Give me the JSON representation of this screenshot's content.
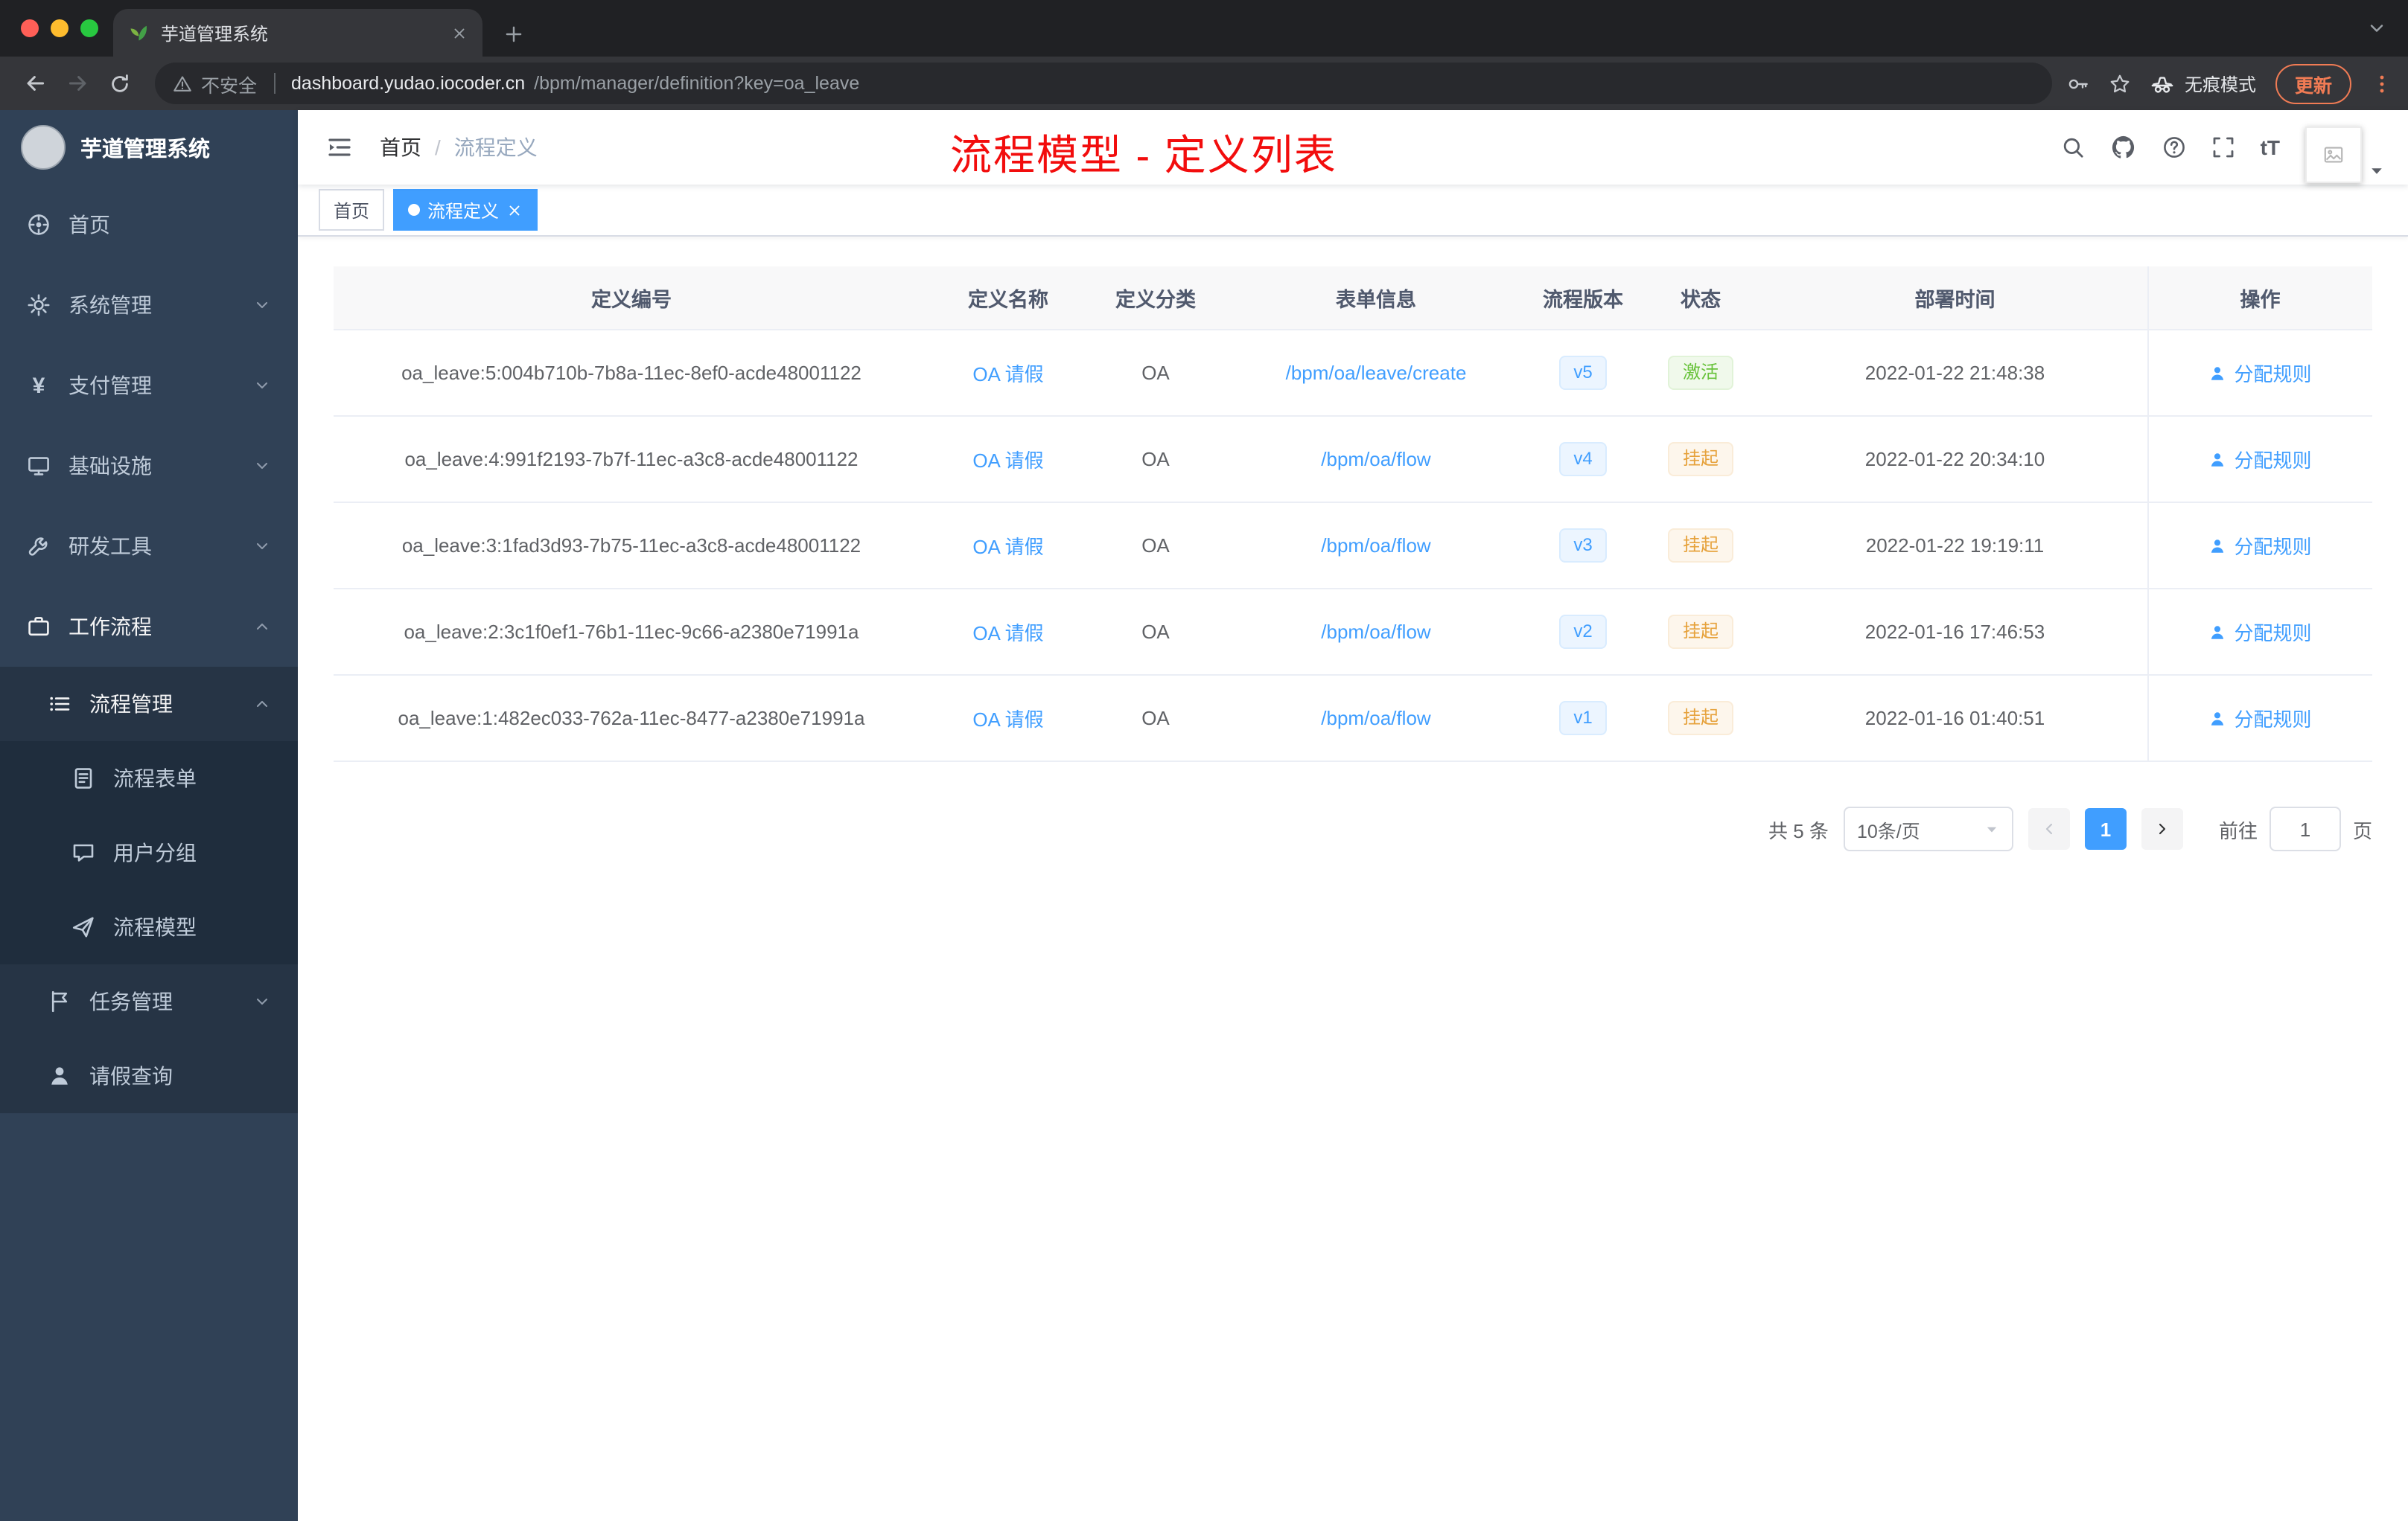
{
  "colors": {
    "accent": "#409eff",
    "success": "#67c23a",
    "warning": "#e6a23c",
    "annotation_red": "#f20d0d",
    "sidebar_bg": "#304156"
  },
  "icons": {
    "font_size": "tT",
    "yen": "¥"
  },
  "browser": {
    "tab_title": "芋道管理系统",
    "security_label": "不安全",
    "url_host": "dashboard.yudao.iocoder.cn",
    "url_path": "/bpm/manager/definition?key=oa_leave",
    "incognito_label": "无痕模式",
    "update_label": "更新"
  },
  "sidebar": {
    "logo_title": "芋道管理系统",
    "items": [
      {
        "label": "首页"
      },
      {
        "label": "系统管理"
      },
      {
        "label": "支付管理"
      },
      {
        "label": "基础设施"
      },
      {
        "label": "研发工具"
      },
      {
        "label": "工作流程"
      },
      {
        "label": "流程管理"
      },
      {
        "label": "流程表单"
      },
      {
        "label": "用户分组"
      },
      {
        "label": "流程模型"
      },
      {
        "label": "任务管理"
      },
      {
        "label": "请假查询"
      }
    ]
  },
  "header": {
    "breadcrumb": [
      "首页",
      "流程定义"
    ],
    "breadcrumb_separator": "/",
    "annotation": "流程模型 - 定义列表"
  },
  "tags": [
    {
      "label": "首页"
    },
    {
      "label": "流程定义"
    }
  ],
  "table": {
    "columns": [
      "定义编号",
      "定义名称",
      "定义分类",
      "表单信息",
      "流程版本",
      "状态",
      "部署时间",
      "操作"
    ],
    "rows": [
      {
        "id": "oa_leave:5:004b710b-7b8a-11ec-8ef0-acde48001122",
        "name": "OA 请假",
        "category": "OA",
        "form": "/bpm/oa/leave/create",
        "version": "v5",
        "status": "激活",
        "deploy_time": "2022-01-22 21:48:38",
        "action": "分配规则"
      },
      {
        "id": "oa_leave:4:991f2193-7b7f-11ec-a3c8-acde48001122",
        "name": "OA 请假",
        "category": "OA",
        "form": "/bpm/oa/flow",
        "version": "v4",
        "status": "挂起",
        "deploy_time": "2022-01-22 20:34:10",
        "action": "分配规则"
      },
      {
        "id": "oa_leave:3:1fad3d93-7b75-11ec-a3c8-acde48001122",
        "name": "OA 请假",
        "category": "OA",
        "form": "/bpm/oa/flow",
        "version": "v3",
        "status": "挂起",
        "deploy_time": "2022-01-22 19:19:11",
        "action": "分配规则"
      },
      {
        "id": "oa_leave:2:3c1f0ef1-76b1-11ec-9c66-a2380e71991a",
        "name": "OA 请假",
        "category": "OA",
        "form": "/bpm/oa/flow",
        "version": "v2",
        "status": "挂起",
        "deploy_time": "2022-01-16 17:46:53",
        "action": "分配规则"
      },
      {
        "id": "oa_leave:1:482ec033-762a-11ec-8477-a2380e71991a",
        "name": "OA 请假",
        "category": "OA",
        "form": "/bpm/oa/flow",
        "version": "v1",
        "status": "挂起",
        "deploy_time": "2022-01-16 01:40:51",
        "action": "分配规则"
      }
    ]
  },
  "pagination": {
    "total": "共 5 条",
    "page_size": "10条/页",
    "current_page": "1",
    "goto_label": "前往",
    "goto_value": "1",
    "goto_unit": "页"
  }
}
